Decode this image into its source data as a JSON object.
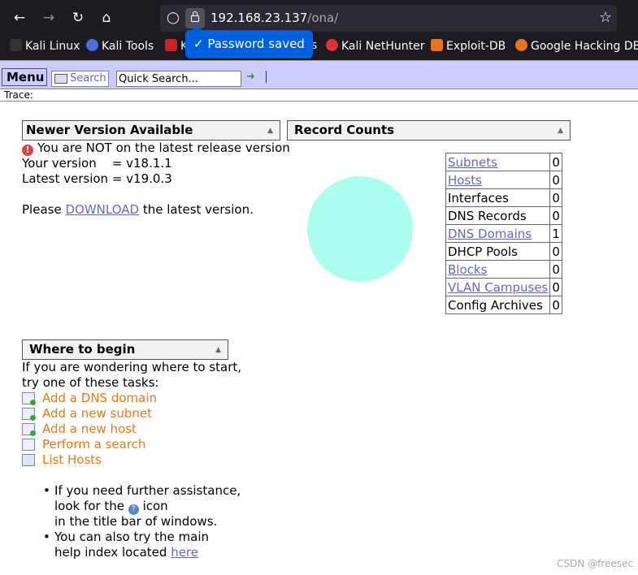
{
  "browser": {
    "url_host": "192.168.23.137",
    "url_path": "/ona/",
    "bookmarks": [
      "Kali Linux",
      "Kali Tools",
      "K",
      "s",
      "Kali NetHunter",
      "Exploit-DB",
      "Google Hacking DB"
    ],
    "toast": "Password saved",
    "icons": [
      "back-icon",
      "forward-icon",
      "reload-icon",
      "home-icon",
      "shield-icon",
      "lock-icon",
      "star-icon"
    ]
  },
  "toolbar": {
    "menu_label": "Menu",
    "search_label": "Search",
    "quick_search_value": "Quick Search...",
    "trace_label": "Trace:"
  },
  "version_panel": {
    "title": "Newer Version Available",
    "warning": "You are NOT on the latest release version",
    "your_version": "Your version    = v18.1.1",
    "latest_version": "Latest version = v19.0.3",
    "download_prefix": "Please",
    "download_link": "DOWNLOAD",
    "download_suffix": "the latest version."
  },
  "record_counts": {
    "title": "Record Counts",
    "rows": [
      {
        "label": "Subnets",
        "count": "0",
        "link": true
      },
      {
        "label": "Hosts",
        "count": "0",
        "link": true
      },
      {
        "label": "Interfaces",
        "count": "0",
        "link": false
      },
      {
        "label": "DNS Records",
        "count": "0",
        "link": false
      },
      {
        "label": "DNS Domains",
        "count": "1",
        "link": true
      },
      {
        "label": "DHCP Pools",
        "count": "0",
        "link": false
      },
      {
        "label": "Blocks",
        "count": "0",
        "link": true
      },
      {
        "label": "VLAN Campuses",
        "count": "0",
        "link": true
      },
      {
        "label": "Config Archives",
        "count": "0",
        "link": false
      }
    ],
    "pie_color": "#aaffee"
  },
  "begin_panel": {
    "title": "Where to begin",
    "intro_1": "If you are wondering where to start,",
    "intro_2": "try one of these tasks:",
    "tasks": [
      "Add a DNS domain",
      "Add a new subnet",
      "Add a new host",
      "Perform a search",
      "List Hosts"
    ],
    "help_1a": "If you need further assistance,",
    "help_1b_pre": "look for the",
    "help_1b_post": "icon",
    "help_1c": "in the title bar of windows.",
    "help_2a": "You can also try the main",
    "help_2b": "help index located",
    "help_2_link": "here"
  },
  "watermark": "CSDN @freesec",
  "colors": {
    "chrome_bg": "#1c1b22",
    "toast_bg": "#0061e0",
    "appbar_bg": "#ccccff",
    "link": "#6666cc",
    "task_link": "#ee7711"
  }
}
